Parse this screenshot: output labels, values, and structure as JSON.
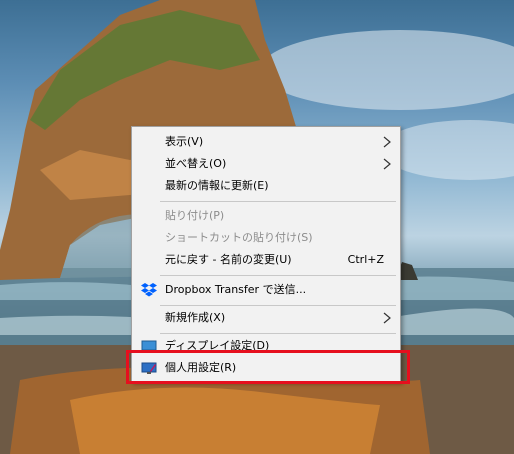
{
  "context_menu": {
    "items": [
      {
        "label": "表示(V)",
        "submenu": true
      },
      {
        "label": "並べ替え(O)",
        "submenu": true
      },
      {
        "label": "最新の情報に更新(E)"
      },
      {
        "label": "貼り付け(P)",
        "disabled": true
      },
      {
        "label": "ショートカットの貼り付け(S)",
        "disabled": true
      },
      {
        "label": "元に戻す - 名前の変更(U)",
        "shortcut": "Ctrl+Z"
      },
      {
        "label": "Dropbox Transfer で送信...",
        "icon": "dropbox-icon"
      },
      {
        "label": "新規作成(X)",
        "submenu": true
      },
      {
        "label": "ディスプレイ設定(D)",
        "icon": "display-settings-icon"
      },
      {
        "label": "個人用設定(R)",
        "icon": "personalize-icon"
      }
    ]
  },
  "colors": {
    "highlight_border": "#e60f1e",
    "dropbox_blue": "#0061fe",
    "menu_background": "#f2f2f2"
  }
}
